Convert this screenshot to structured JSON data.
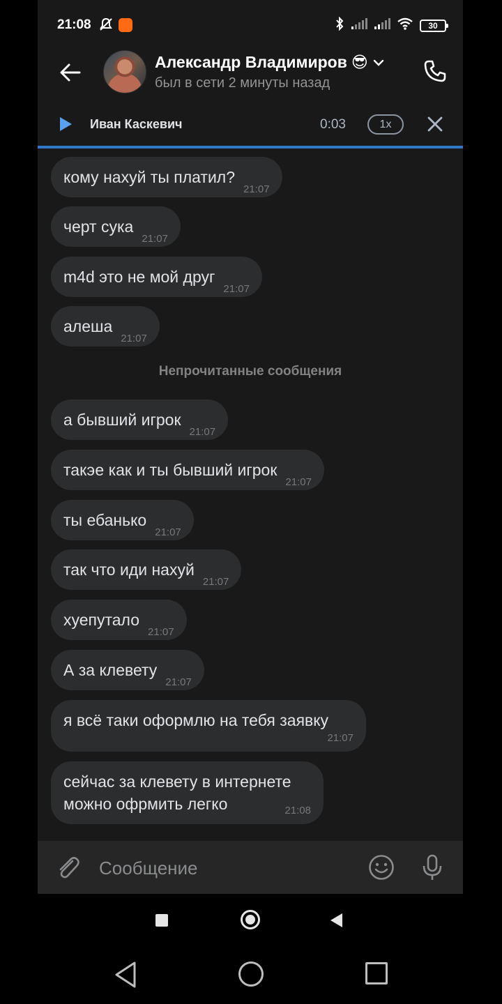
{
  "status_bar": {
    "time": "21:08",
    "battery": "30",
    "icons": [
      "mute-bell-icon",
      "app-notification-icon",
      "bluetooth-icon",
      "signal-icon",
      "signal-icon",
      "wifi-icon",
      "battery-icon"
    ]
  },
  "header": {
    "contact_name": "Александр Владимиров",
    "contact_emoji": "😎",
    "last_seen": "был в сети 2 минуты назад",
    "icons": [
      "back-arrow-icon",
      "chevron-down-icon",
      "phone-icon"
    ]
  },
  "player": {
    "track": "Иван Каскевич",
    "elapsed": "0:03",
    "speed": "1x",
    "icons": [
      "play-icon",
      "close-icon"
    ],
    "accent": "#2f78c8"
  },
  "messages": [
    {
      "text": "кому нахуй ты платил?",
      "time": "21:07"
    },
    {
      "text": "черт сука",
      "time": "21:07"
    },
    {
      "text": "m4d это не мой друг",
      "time": "21:07"
    },
    {
      "text": "алеша",
      "time": "21:07"
    },
    {
      "text": "а бывший игрок",
      "time": "21:07"
    },
    {
      "text": "такэе как и ты бывший игрок",
      "time": "21:07"
    },
    {
      "text": "ты ебанько",
      "time": "21:07"
    },
    {
      "text": "так что иди нахуй",
      "time": "21:07"
    },
    {
      "text": "хуепутало",
      "time": "21:07"
    },
    {
      "text": "А за клевету",
      "time": "21:07"
    },
    {
      "text": "я всё таки оформлю на тебя заявку",
      "time": "21:07"
    },
    {
      "text": "сейчас за клевету в интернете можно офрмить легко",
      "time": "21:08"
    }
  ],
  "unread_divider": "Непрочитанные сообщения",
  "composer": {
    "placeholder": "Сообщение",
    "icons": [
      "paperclip-icon",
      "emoji-icon",
      "microphone-icon"
    ]
  },
  "colors": {
    "background": "#19191a",
    "bubble": "#2c2d2e",
    "accent": "#2f78c8"
  }
}
